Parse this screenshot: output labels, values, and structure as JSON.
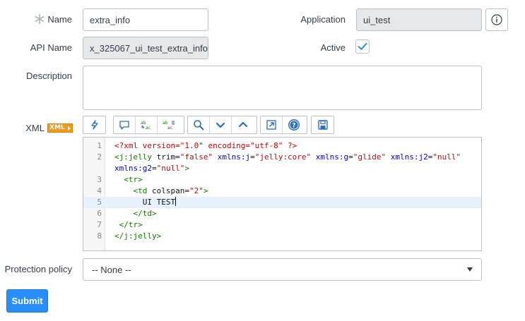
{
  "form": {
    "name_label": "Name",
    "name_value": "extra_info",
    "api_name_label": "API Name",
    "api_name_value": "x_325067_ui_test_extra_info",
    "application_label": "Application",
    "application_value": "ui_test",
    "active_label": "Active",
    "active_checked": true,
    "description_label": "Description",
    "description_value": "",
    "xml_label": "XML",
    "xml_badge": "XML",
    "protection_label": "Protection policy",
    "protection_value": "-- None --",
    "submit_label": "Submit"
  },
  "toolbar": {
    "groups": [
      [
        "format-icon"
      ],
      [
        "comment-icon",
        "replace-icon",
        "replace-all-icon"
      ],
      [
        "search-icon",
        "next-icon",
        "previous-icon"
      ],
      [
        "fullscreen-icon",
        "help-icon"
      ],
      [
        "save-icon"
      ]
    ]
  },
  "editor": {
    "active_line": 5,
    "lines": [
      {
        "n": "1",
        "text": "<?xml version=\"1.0\" encoding=\"utf-8\" ?>"
      },
      {
        "n": "2",
        "text": "<j:jelly trim=\"false\" xmlns:j=\"jelly:core\" xmlns:g=\"glide\" xmlns:j2=\"null\""
      },
      {
        "n": "",
        "text": "xmlns:g2=\"null\">"
      },
      {
        "n": "3",
        "text": "  <tr>"
      },
      {
        "n": "4",
        "text": "    <td colspan=\"2\">"
      },
      {
        "n": "5",
        "text": "      UI TEST"
      },
      {
        "n": "6",
        "text": "    </td>"
      },
      {
        "n": "7",
        "text": " </tr>"
      },
      {
        "n": "8",
        "text": "</j:jelly>"
      }
    ]
  },
  "colors": {
    "primary_button": "#278efc",
    "xml_badge": "#f19a1b",
    "checkbox_check": "#278efc"
  }
}
